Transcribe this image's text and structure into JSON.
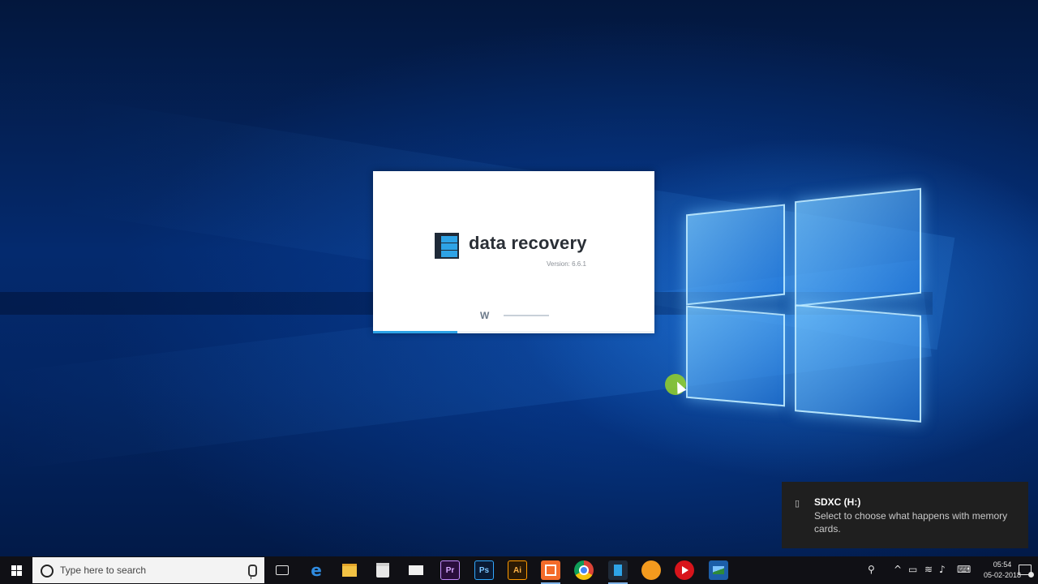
{
  "splash": {
    "title": "data recovery",
    "version": "Version: 6.6.1",
    "brand_mark": "W",
    "progress_percent": 30,
    "accent_color": "#2ea3e6"
  },
  "notification": {
    "icon": "sd-card-icon",
    "title": "SDXC (H:)",
    "body": "Select to choose what happens with memory cards."
  },
  "taskbar": {
    "search_placeholder": "Type here to search",
    "apps": [
      {
        "name": "task-view-icon"
      },
      {
        "name": "edge-icon",
        "glyph": "e"
      },
      {
        "name": "file-explorer-icon"
      },
      {
        "name": "store-icon"
      },
      {
        "name": "mail-icon"
      },
      {
        "name": "premiere-pro-icon",
        "label": "Pr"
      },
      {
        "name": "photoshop-icon",
        "label": "Ps"
      },
      {
        "name": "illustrator-icon",
        "label": "Ai"
      },
      {
        "name": "recoverit-icon"
      },
      {
        "name": "chrome-icon"
      },
      {
        "name": "data-recovery-icon"
      },
      {
        "name": "vlc-icon"
      },
      {
        "name": "media-player-icon"
      },
      {
        "name": "photos-icon"
      }
    ]
  },
  "clock": {
    "time": "05:54",
    "date": "05-02-2018"
  }
}
